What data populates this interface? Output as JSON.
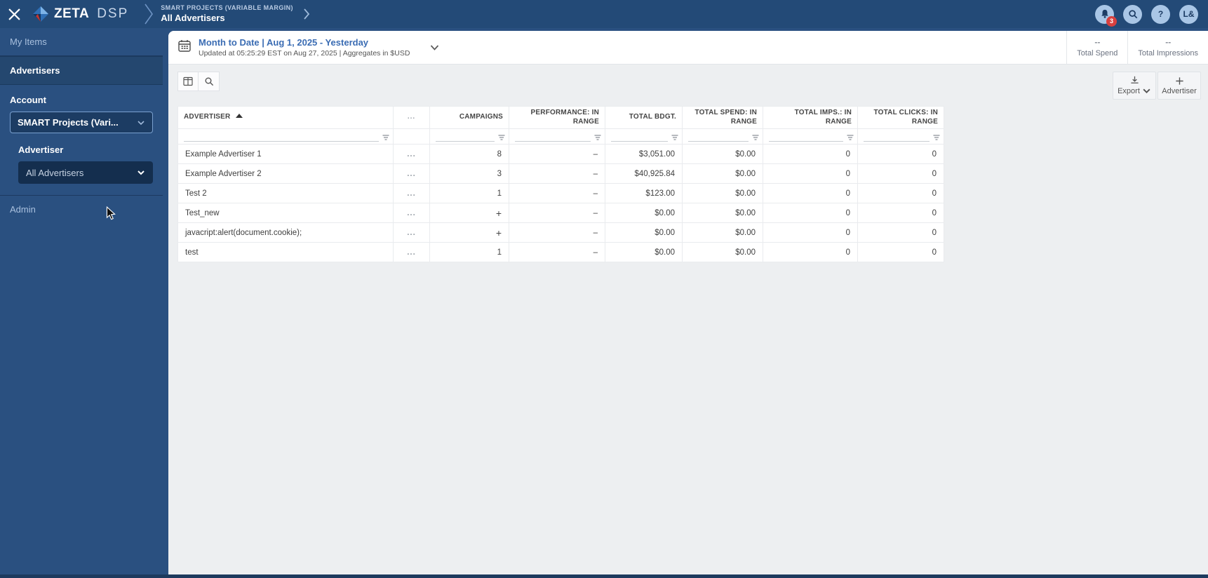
{
  "topbar": {
    "logo_zeta": "ZETA",
    "logo_dsp": "DSP",
    "breadcrumb": {
      "account": "SMART PROJECTS (VARIABLE MARGIN)",
      "page": "All Advertisers"
    },
    "notification_count": "3",
    "help_label": "?",
    "avatar_initials": "L&"
  },
  "sidebar": {
    "my_items": "My Items",
    "advertisers": "Advertisers",
    "account_label": "Account",
    "account_value": "SMART Projects (Vari...",
    "advertiser_label": "Advertiser",
    "advertiser_value": "All Advertisers",
    "admin": "Admin"
  },
  "datebar": {
    "range": "Month to Date | Aug 1, 2025 - Yesterday",
    "updated": "Updated at 05:25:29 EST on Aug 27, 2025 | Aggregates in $USD",
    "stats": [
      {
        "value": "--",
        "label": "Total Spend"
      },
      {
        "value": "--",
        "label": "Total Impressions"
      }
    ]
  },
  "toolbar": {
    "export_label": "Export",
    "advertiser_label": "Advertiser"
  },
  "table": {
    "columns": [
      {
        "label": "ADVERTISER",
        "sort": "asc"
      },
      {
        "label": "..."
      },
      {
        "label": "CAMPAIGNS"
      },
      {
        "label": "PERFORMANCE: IN RANGE"
      },
      {
        "label": "TOTAL BDGT."
      },
      {
        "label": "TOTAL SPEND: IN RANGE"
      },
      {
        "label": "TOTAL IMPS.: IN RANGE"
      },
      {
        "label": "TOTAL CLICKS: IN RANGE"
      }
    ],
    "rows": [
      {
        "cells": [
          "Example Advertiser 1",
          "...",
          "8",
          "–",
          "$3,051.00",
          "$0.00",
          "0",
          "0"
        ]
      },
      {
        "cells": [
          "Example Advertiser 2",
          "...",
          "3",
          "–",
          "$40,925.84",
          "$0.00",
          "0",
          "0"
        ]
      },
      {
        "cells": [
          "Test 2",
          "...",
          "1",
          "–",
          "$123.00",
          "$0.00",
          "0",
          "0"
        ]
      },
      {
        "cells": [
          "Test_new",
          "...",
          "+",
          "–",
          "$0.00",
          "$0.00",
          "0",
          "0"
        ]
      },
      {
        "cells": [
          "javacript:alert(document.cookie);",
          "...",
          "+",
          "–",
          "$0.00",
          "$0.00",
          "0",
          "0"
        ]
      },
      {
        "cells": [
          "test",
          "...",
          "1",
          "–",
          "$0.00",
          "$0.00",
          "0",
          "0"
        ]
      }
    ]
  },
  "colors": {
    "topbar": "#234a77",
    "sidebar": "#2a5080",
    "link_blue": "#3a6cb3",
    "badge_red": "#d8403f",
    "circle_button": "#a9c6e6",
    "panel_bg": "#edeff1"
  }
}
